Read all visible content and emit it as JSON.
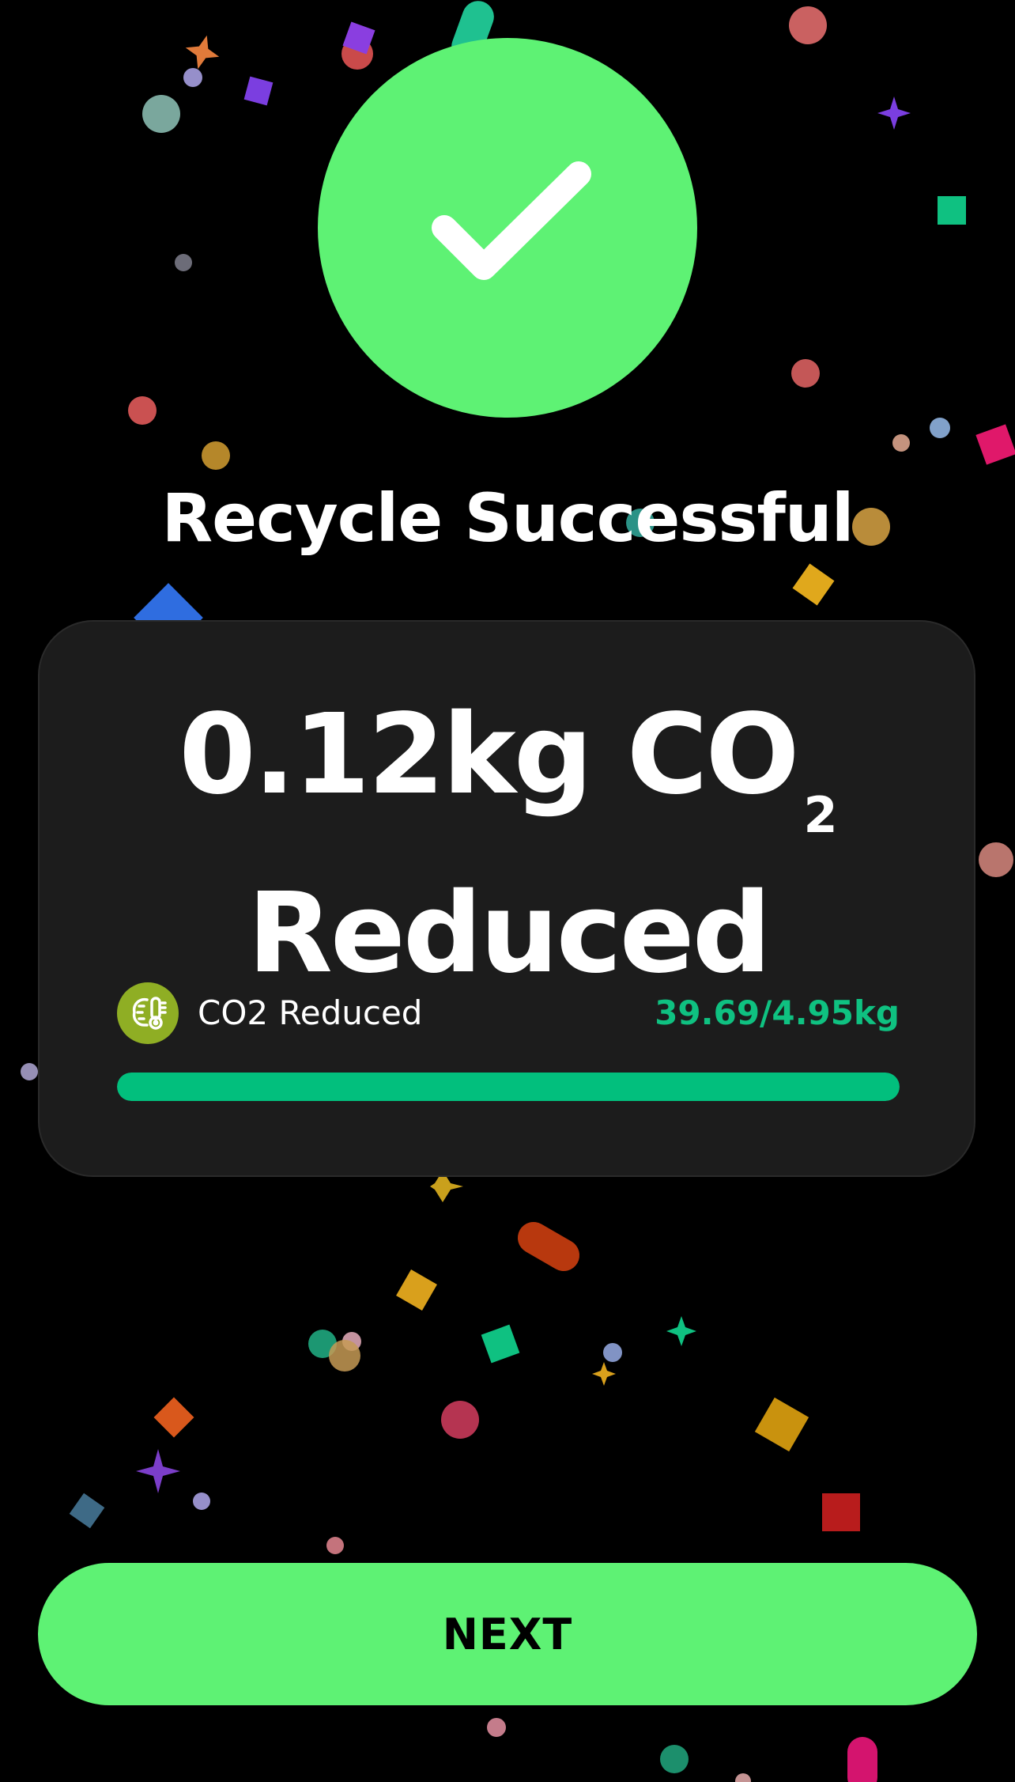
{
  "header": {
    "status_icon": "checkmark-icon",
    "title": "Recycle Successful"
  },
  "result_card": {
    "headline_line1": "0.12kg CO",
    "headline_subscript": "2",
    "headline_line2": "Reduced",
    "metric": {
      "icon": "co2-thermometer-icon",
      "label": "CO2 Reduced",
      "value": "39.69/4.95kg",
      "progress_fraction": 1.0
    }
  },
  "footer": {
    "next_label": "NEXT"
  },
  "colors": {
    "accent_green": "#5ef274",
    "progress_green": "#02bf7d",
    "value_green": "#0fc181",
    "icon_bg": "#8fae24",
    "card_bg": "#1c1c1c",
    "page_bg": "#000000"
  }
}
